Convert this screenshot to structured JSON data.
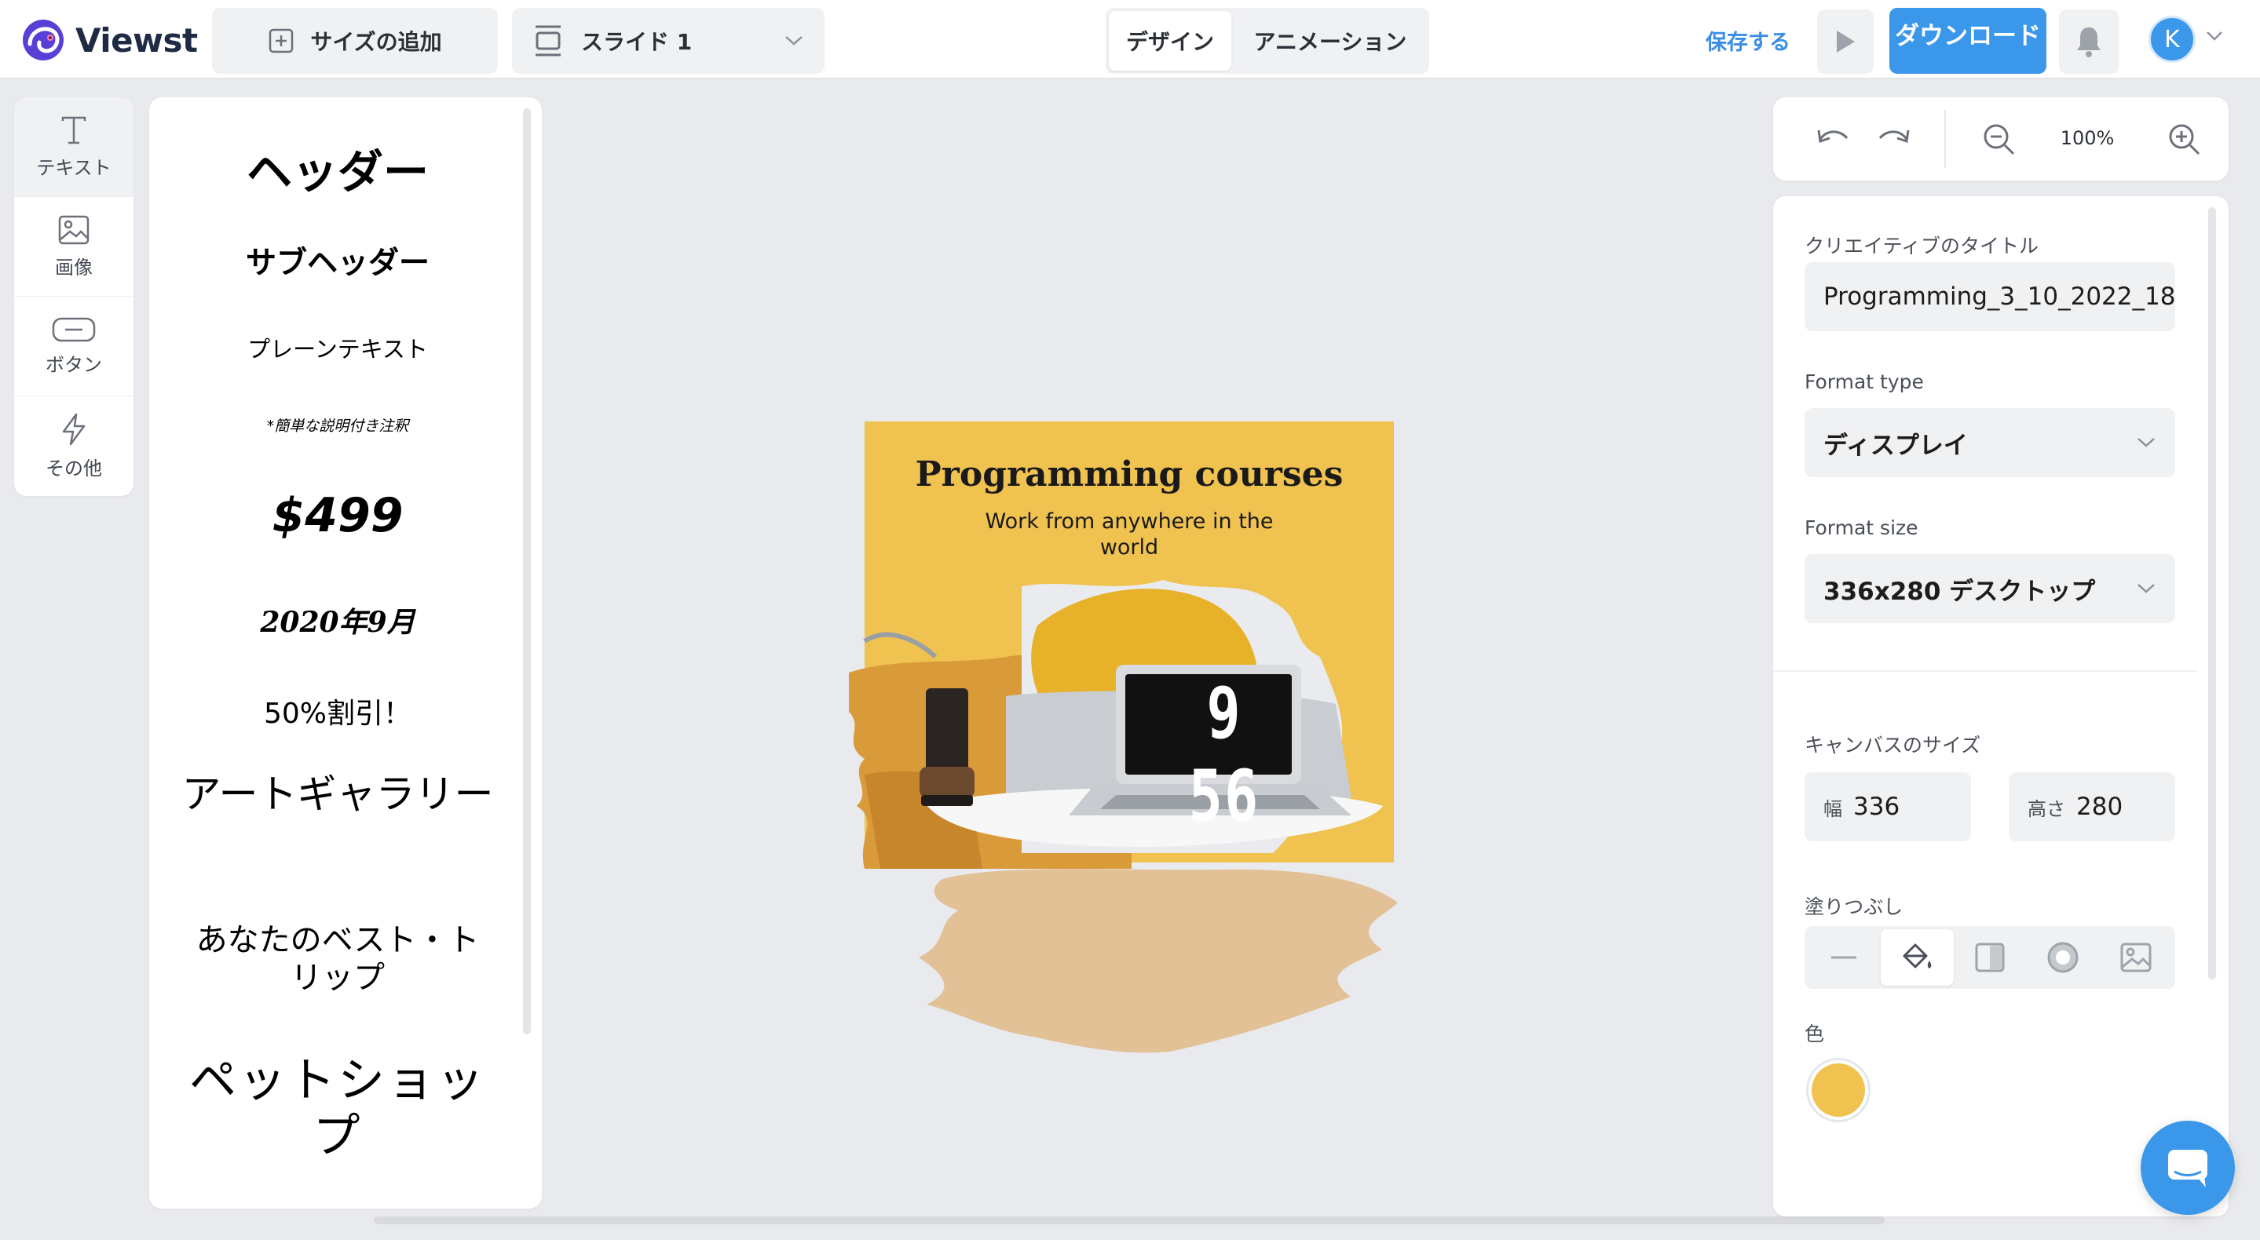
{
  "app": {
    "name": "Viewst"
  },
  "toolbar": {
    "add_size": "サイズの追加",
    "slide_selector": "スライド 1",
    "mode_design": "デザイン",
    "mode_animation": "アニメーション",
    "save": "保存する",
    "download": "ダウンロード",
    "user_initial": "K"
  },
  "rail": {
    "items": [
      {
        "label": "テキスト",
        "icon": "text-icon"
      },
      {
        "label": "画像",
        "icon": "image-icon"
      },
      {
        "label": "ボタン",
        "icon": "button-icon"
      },
      {
        "label": "その他",
        "icon": "lightning-icon"
      }
    ]
  },
  "presets": {
    "header": "ヘッダー",
    "subheader": "サブヘッダー",
    "plain": "プレーンテキスト",
    "note": "*簡単な説明付き注釈",
    "price": "$499",
    "date": "2020年9月",
    "discount": "50%割引！",
    "gallery": "アートギャラリー",
    "trip": "あなたのベスト・トリップ",
    "pet_shop": "ペットショップ"
  },
  "creative": {
    "title": "Programming courses",
    "subtitle": "Work from anywhere in the world",
    "clock": "9 56",
    "background": "#f0c24f"
  },
  "zoom": {
    "value": "100%"
  },
  "properties": {
    "title_label": "クリエイティブのタイトル",
    "title_value": "Programming_3_10_2022_18",
    "format_type_label": "Format type",
    "format_type_value": "ディスプレイ",
    "format_size_label": "Format size",
    "format_size_value": "336x280 デスクトップ",
    "canvas_size_label": "キャンバスのサイズ",
    "width_prefix": "幅",
    "width_value": "336",
    "height_prefix": "高さ",
    "height_value": "280",
    "fill_label": "塗りつぶし",
    "color_label": "色",
    "color_value": "#f0c24f"
  },
  "colors": {
    "accent": "#3a97ea",
    "brand_dark": "#1f2a44"
  }
}
